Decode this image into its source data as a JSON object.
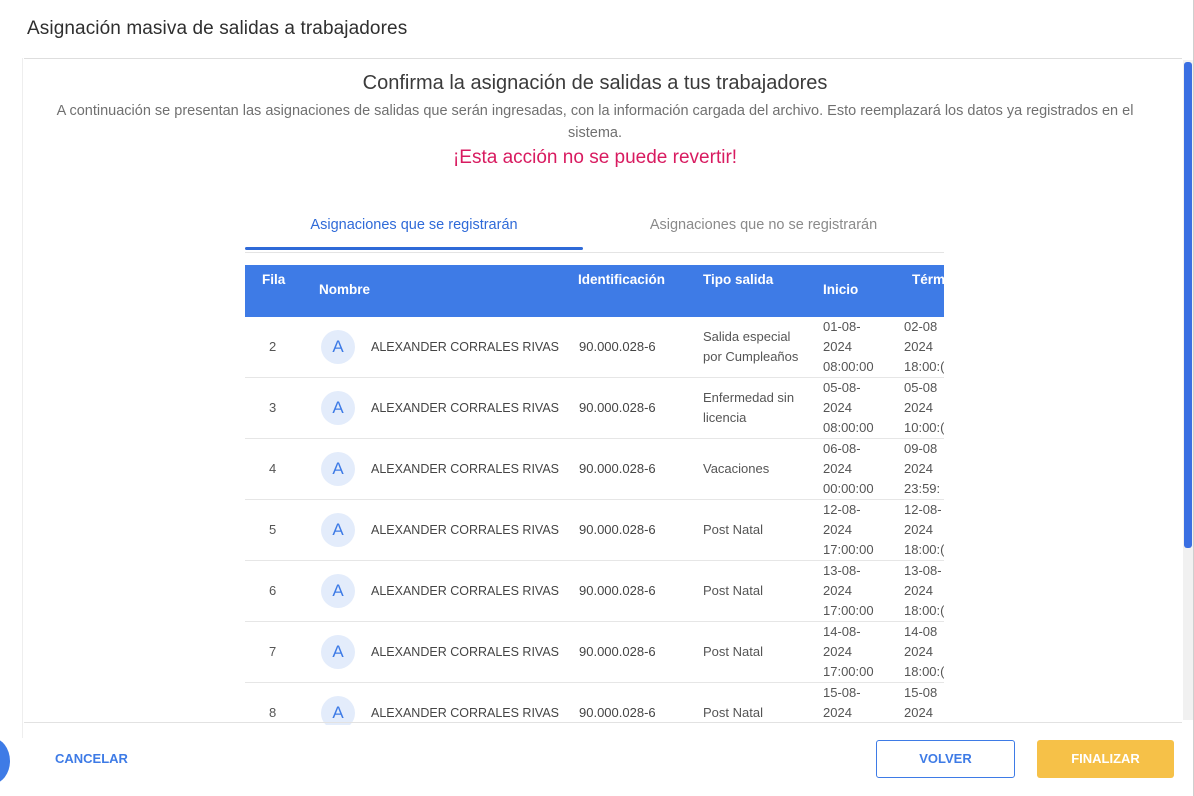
{
  "dialog": {
    "title": "Asignación masiva de salidas a trabajadores"
  },
  "content": {
    "subtitle": "Confirma la asignación de salidas a tus trabajadores",
    "description": "A continuación se presentan las asignaciones de salidas que serán ingresadas, con la información cargada del archivo. Esto reemplazará los datos ya registrados en el sistema.",
    "warning": "¡Esta acción no se puede revertir!"
  },
  "tabs": [
    {
      "label": "Asignaciones que se registrarán",
      "active": true
    },
    {
      "label": "Asignaciones que no se registrarán",
      "active": false
    }
  ],
  "table": {
    "headers": {
      "fila": "Fila",
      "nombre": "Nombre",
      "identificacion": "Identificación",
      "tipo_salida": "Tipo salida",
      "inicio": "Inicio",
      "termino": "Térm"
    },
    "rows": [
      {
        "fila": "2",
        "avatar": "A",
        "nombre": "ALEXANDER CORRALES RIVAS",
        "identificacion": "90.000.028-6",
        "tipo_salida": "Salida especial por Cumpleaños",
        "inicio": [
          "01-08-",
          "2024",
          "08:00:00"
        ],
        "termino": [
          "02-08",
          "2024",
          "18:00:("
        ]
      },
      {
        "fila": "3",
        "avatar": "A",
        "nombre": "ALEXANDER CORRALES RIVAS",
        "identificacion": "90.000.028-6",
        "tipo_salida": "Enfermedad sin licencia",
        "inicio": [
          "05-08-",
          "2024",
          "08:00:00"
        ],
        "termino": [
          "05-08",
          "2024",
          "10:00:("
        ]
      },
      {
        "fila": "4",
        "avatar": "A",
        "nombre": "ALEXANDER CORRALES RIVAS",
        "identificacion": "90.000.028-6",
        "tipo_salida": "Vacaciones",
        "inicio": [
          "06-08-",
          "2024",
          "00:00:00"
        ],
        "termino": [
          "09-08",
          "2024",
          "23:59:"
        ]
      },
      {
        "fila": "5",
        "avatar": "A",
        "nombre": "ALEXANDER CORRALES RIVAS",
        "identificacion": "90.000.028-6",
        "tipo_salida": "Post Natal",
        "inicio": [
          "12-08-",
          "2024",
          "17:00:00"
        ],
        "termino": [
          "12-08-",
          "2024",
          "18:00:("
        ]
      },
      {
        "fila": "6",
        "avatar": "A",
        "nombre": "ALEXANDER CORRALES RIVAS",
        "identificacion": "90.000.028-6",
        "tipo_salida": "Post Natal",
        "inicio": [
          "13-08-",
          "2024",
          "17:00:00"
        ],
        "termino": [
          "13-08-",
          "2024",
          "18:00:("
        ]
      },
      {
        "fila": "7",
        "avatar": "A",
        "nombre": "ALEXANDER CORRALES RIVAS",
        "identificacion": "90.000.028-6",
        "tipo_salida": "Post Natal",
        "inicio": [
          "14-08-",
          "2024",
          "17:00:00"
        ],
        "termino": [
          "14-08",
          "2024",
          "18:00:("
        ]
      },
      {
        "fila": "8",
        "avatar": "A",
        "nombre": "ALEXANDER CORRALES RIVAS",
        "identificacion": "90.000.028-6",
        "tipo_salida": "Post Natal",
        "inicio": [
          "15-08-",
          "2024",
          ""
        ],
        "termino": [
          "15-08",
          "2024",
          ""
        ]
      }
    ]
  },
  "footer": {
    "cancel_label": "CANCELAR",
    "back_label": "VOLVER",
    "finish_label": "FINALIZAR"
  },
  "colors": {
    "primary": "#3e7be6",
    "warning": "#d81b60",
    "finish_button": "#f6c148"
  }
}
